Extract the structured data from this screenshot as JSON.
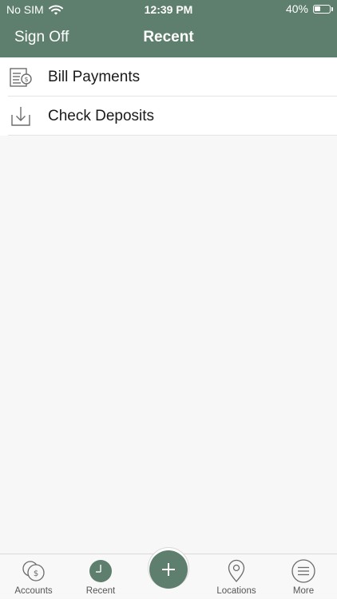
{
  "status_bar": {
    "carrier": "No SIM",
    "time": "12:39 PM",
    "battery_percent": "40%",
    "battery_level": 0.4
  },
  "header": {
    "sign_off_label": "Sign Off",
    "title": "Recent"
  },
  "recent_items": [
    {
      "label": "Bill Payments",
      "icon": "bill-payment-icon"
    },
    {
      "label": "Check Deposits",
      "icon": "check-deposit-icon"
    }
  ],
  "tab_bar": {
    "tabs": [
      {
        "label": "Accounts",
        "icon": "accounts-icon"
      },
      {
        "label": "Recent",
        "icon": "recent-clock-icon",
        "active": true
      },
      {
        "label": "",
        "icon": "add-icon"
      },
      {
        "label": "Locations",
        "icon": "location-pin-icon"
      },
      {
        "label": "More",
        "icon": "menu-icon"
      }
    ]
  },
  "colors": {
    "brand": "#5e7f6e",
    "background": "#f7f7f7",
    "icon_gray": "#6b6b6b"
  }
}
